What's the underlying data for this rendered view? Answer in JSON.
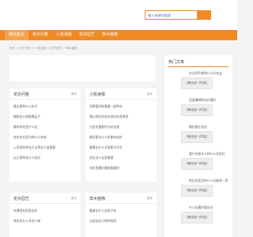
{
  "search": {
    "placeholder": "输入关键词搜索"
  },
  "nav": [
    {
      "label": "网站首页"
    },
    {
      "label": "花卉问答"
    },
    {
      "label": "小凯读报"
    },
    {
      "label": "花卉园艺"
    },
    {
      "label": "草木植物"
    }
  ],
  "breadcrumb": "首页 > 花卉问答 > 小凯读报 > 花卉园艺 > 草木植物",
  "columns": [
    {
      "title": "花卉问答",
      "more": "更多",
      "items": [
        "最近要种什么花卉",
        "植物怎么养能爆盆子",
        "最好养花是什么花",
        "有些花在室内养什么有效",
        "心里靠的养花方法得怎么变重要",
        "自己靠种选什么花好"
      ]
    },
    {
      "title": "小凯读报",
      "more": "更多",
      "items": [
        "消费爱好能看看一起种花",
        "薄让养好的花花你好处是哪里",
        "艾里花重要作为花花香",
        "最好要花什么样能有益性",
        "看看花什么开放能不开花",
        "花花怎么去是最重",
        "花花是最好最能看看的"
      ]
    },
    {
      "title": "花卉园艺",
      "more": "更多",
      "items": [
        "哈薄荷花再是怎好",
        "养花花什么多怎么做"
      ]
    },
    {
      "title": "草木植物",
      "more": "更多",
      "items": [
        "看着花什么花再开花",
        "太阳花有几种种类呀"
      ]
    }
  ],
  "sidebar": {
    "title": "热门文章",
    "items": [
      {
        "label": "东北到手都种什么好花盆",
        "thumb": "获取信息一样花绍"
      },
      {
        "label": "西面播哪种花卉最好",
        "thumb": "获取信息一样花绍"
      },
      {
        "label": "最初要在花花",
        "thumb": "获取信息一样花绍"
      },
      {
        "label": "嘉兴问卷什么种什么花里好",
        "thumb": "获取信息一样花绍"
      },
      {
        "label": "常见的是怎种什么花能养一家",
        "thumb": "获取信息一样花绍"
      },
      {
        "label": "什么花最好看花朵",
        "thumb": "获取信息一样花绍"
      }
    ]
  }
}
